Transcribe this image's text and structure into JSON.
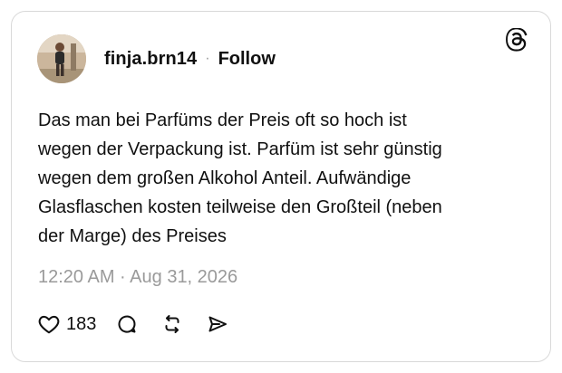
{
  "post": {
    "username": "finja.brn14",
    "separator": "·",
    "follow_label": "Follow",
    "text": "Das man bei Parfüms der Preis oft so hoch ist\nwegen der Verpackung ist. Parfüm ist sehr günstig\nwegen dem großen Alkohol Anteil. Aufwändige\nGlasflaschen kosten teilweise den Großteil (neben\nder Marge) des Preises",
    "timestamp": "12:20 AM · Aug 31, 2026",
    "like_count": "183"
  },
  "icons": {
    "brand": "threads-icon",
    "like": "heart-icon",
    "reply": "comment-icon",
    "repost": "repost-icon",
    "share": "share-icon"
  },
  "colors": {
    "text": "#101010",
    "muted": "#9a9a9a",
    "border": "#d9d9d9"
  }
}
